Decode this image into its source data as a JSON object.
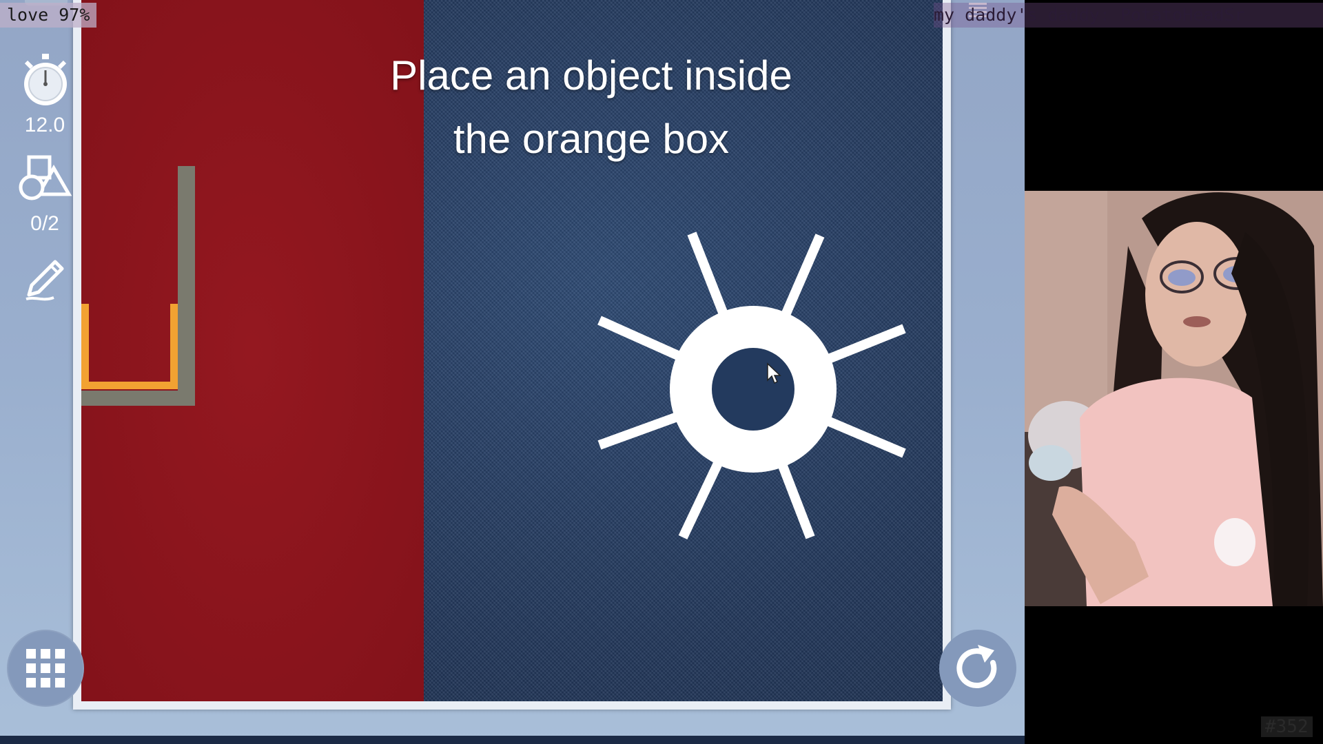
{
  "overlay": {
    "love_text": "love 97%",
    "ticker_text": "my daddy's daddy: PotatoHeadSr",
    "counter_text": "#352"
  },
  "game": {
    "instruction_line1": "Place an object inside",
    "instruction_line2": "the orange box",
    "timer_value": "12.0",
    "shapes_value": "0/2",
    "icons": {
      "timer": "stopwatch-icon",
      "shapes": "shapes-icon",
      "draw": "pencil-icon",
      "menu": "grid-menu-icon",
      "restart": "restart-icon"
    },
    "colors": {
      "red_zone": "#8b141b",
      "board": "#243a5e",
      "orange_box": "#f2a232",
      "wall": "#7a7a6e",
      "sun": "#ffffff"
    }
  },
  "webcam": {
    "description_icon": "webcam-feed"
  }
}
